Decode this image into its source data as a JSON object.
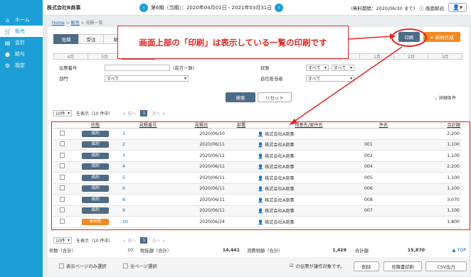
{
  "app": {
    "company": "株式会社B商事"
  },
  "period": {
    "text": "第6期（当期）：2020年04月01日 - 2021年03月31日",
    "prev_icon": "chevron-left-icon",
    "next_icon": "chevron-right-icon"
  },
  "topright": {
    "subscription": "(無料期間：2020/06/30 まで)",
    "help": "画面解説"
  },
  "sidebar": {
    "items": [
      {
        "label": "ホーム",
        "icon": "home-icon",
        "glyph": "⌂"
      },
      {
        "label": "販売",
        "icon": "cart-icon",
        "glyph": "🛒"
      },
      {
        "label": "会計",
        "icon": "ledger-icon",
        "glyph": "▤"
      },
      {
        "label": "給与",
        "icon": "coin-icon",
        "glyph": "●"
      },
      {
        "label": "設定",
        "icon": "gear-icon",
        "glyph": "⚙"
      }
    ]
  },
  "breadcrumb": {
    "home": "Home",
    "sep": ">",
    "sales": "販売",
    "current": "見積一覧"
  },
  "tabs": [
    "見積",
    "受注",
    "納"
  ],
  "toolbar": {
    "print": "印刷",
    "new": "+ 新規作成"
  },
  "months": [
    "4月",
    "5月",
    "6月",
    "7月",
    "8月",
    "9月",
    "10月",
    "11月",
    "12月",
    "1月",
    "2月",
    "3月"
  ],
  "active_month": "6月",
  "search": {
    "slip_no_label": "伝票番号",
    "slip_no_hint": "(前方一致)",
    "dept_label": "部門",
    "dept_value": "すべて",
    "status_label": "状態",
    "status_value1": "すべて",
    "status_value2": "すべて",
    "staff_label": "自社担当者",
    "staff_value": "すべて",
    "search_btn": "検索",
    "reset_btn": "リセット",
    "detail": "詳細条件"
  },
  "pager": {
    "per_page": "10件",
    "showing": "を表示（10 件中）",
    "prev": "< 前へ",
    "page": "1",
    "next": "次へ >"
  },
  "table": {
    "headers": [
      "状態",
      "見積番号",
      "見積日",
      "部署",
      "得意先/案件名",
      "件名",
      "合計額"
    ],
    "rows": [
      {
        "status": "成約",
        "type": "won",
        "no": "1",
        "date": "2020/06/10",
        "client": "株式会社A商事",
        "subject": "",
        "total": "2,200"
      },
      {
        "status": "成約",
        "type": "won",
        "no": "2",
        "date": "2020/06/11",
        "client": "株式会社A商事",
        "subject": "001",
        "total": "1,100"
      },
      {
        "status": "成約",
        "type": "won",
        "no": "3",
        "date": "2020/06/11",
        "client": "株式会社A商事",
        "subject": "002",
        "total": "1,100"
      },
      {
        "status": "成約",
        "type": "won",
        "no": "4",
        "date": "2020/06/11",
        "client": "株式会社A商事",
        "subject": "004",
        "total": "2,200"
      },
      {
        "status": "成約",
        "type": "won",
        "no": "5",
        "date": "2020/06/11",
        "client": "株式会社A商事",
        "subject": "005",
        "total": "1,100"
      },
      {
        "status": "成約",
        "type": "won",
        "no": "6",
        "date": "2020/06/11",
        "client": "株式会社A商事",
        "subject": "006",
        "total": "1,100"
      },
      {
        "status": "成約",
        "type": "won",
        "no": "8",
        "date": "2020/06/11",
        "client": "株式会社A商事",
        "subject": "008",
        "total": "3,070"
      },
      {
        "status": "成約",
        "type": "won",
        "no": "9",
        "date": "2020/06/11",
        "client": "株式会社A商事",
        "subject": "007",
        "total": "1,100"
      },
      {
        "status": "未回答",
        "type": "pending",
        "no": "10",
        "date": "2020/06/24",
        "client": "株式会社A商事",
        "subject": "",
        "total": "1,800"
      }
    ]
  },
  "totals": {
    "count_label": "件数（合計）",
    "count": "10",
    "tax_excl_label": "税抜額（合計）",
    "tax_excl": "14,441",
    "tax_label": "消費税額（合計）",
    "tax": "1,429",
    "sum_label": "合計額",
    "sum": "15,870",
    "top": "▲ TOP"
  },
  "footer": {
    "select_page": "表示ページのみ選択",
    "select_all": "全ページ選択",
    "target_note": "の伝票が操作対象です。",
    "delete": "削除",
    "print_estimate": "見積書印刷",
    "csv": "CSV出力"
  },
  "annotation": {
    "text": "画面上部の「印刷」は表示している一覧の印刷です"
  },
  "colors": {
    "accent": "#1b9fd6",
    "navy": "#4d6a86",
    "orange": "#f08a24",
    "annotation": "#e52421"
  }
}
